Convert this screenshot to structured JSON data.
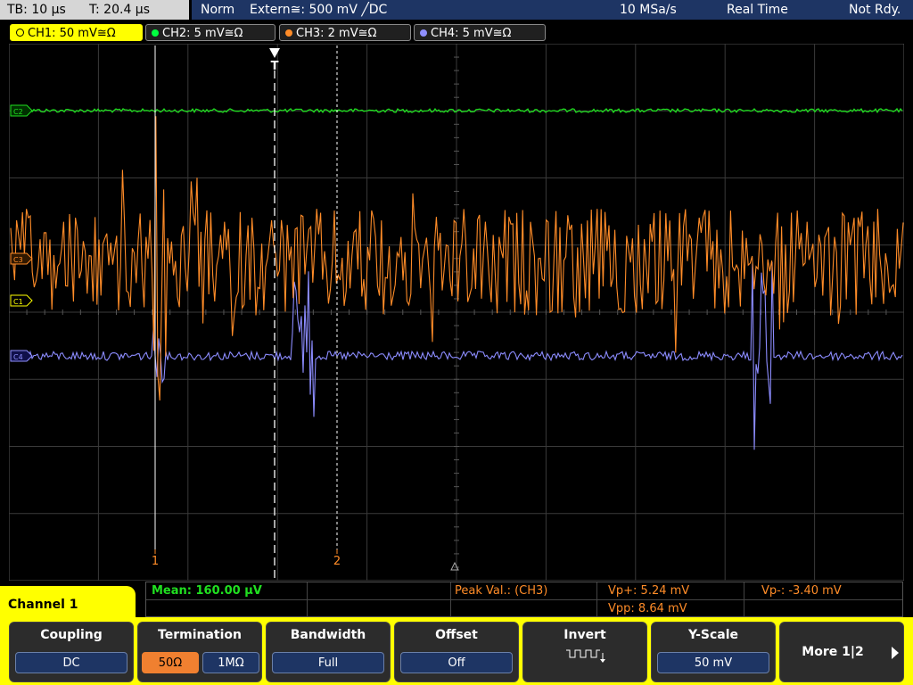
{
  "status": {
    "timebase": "TB: 10 µs",
    "trigger_time": "T: 20.4 µs",
    "mode": "Norm",
    "trigger_source": "Extern≅: 500 mV ╱DC",
    "sample_rate": "10 MSa/s",
    "acquisition": "Real Time",
    "ready": "Not Rdy."
  },
  "channel_tabs": [
    {
      "label": "CH1: 50 mV≅Ω",
      "color": "#ffff00"
    },
    {
      "label": "CH2: 5 mV≅Ω",
      "color": "#00ff40"
    },
    {
      "label": "CH3: 2 mV≅Ω",
      "color": "#ff8c28"
    },
    {
      "label": "CH4: 5 mV≅Ω",
      "color": "#9090ff"
    }
  ],
  "markers": {
    "trigger_marker": "T",
    "cursor1": "1",
    "cursor2": "2",
    "ch1_ref": "C1",
    "ch2_ref": "C2",
    "ch3_ref": "C3",
    "ch4_ref": "C4"
  },
  "measurements": {
    "mean": "Mean: 160.00 µV",
    "peak_label": "Peak Val.:  (CH3)",
    "vp_plus": "Vp+: 5.24 mV",
    "vp_minus": "Vp-: -3.40 mV",
    "vpp": "Vpp: 8.64 mV"
  },
  "menu": {
    "title": "Channel 1",
    "coupling": {
      "label": "Coupling",
      "value": "DC"
    },
    "termination": {
      "label": "Termination",
      "options": [
        "50Ω",
        "1MΩ"
      ],
      "selected": "50Ω"
    },
    "bandwidth": {
      "label": "Bandwidth",
      "value": "Full"
    },
    "offset": {
      "label": "Offset",
      "value": "Off"
    },
    "invert": {
      "label": "Invert"
    },
    "yscale": {
      "label": "Y-Scale",
      "value": "50 mV"
    },
    "more": {
      "label": "More 1|2"
    }
  },
  "colors": {
    "ch1": "#ffff00",
    "ch2": "#00ff40",
    "ch3": "#ff8c28",
    "ch4": "#9090ff",
    "status_bar": "#1e3564"
  }
}
